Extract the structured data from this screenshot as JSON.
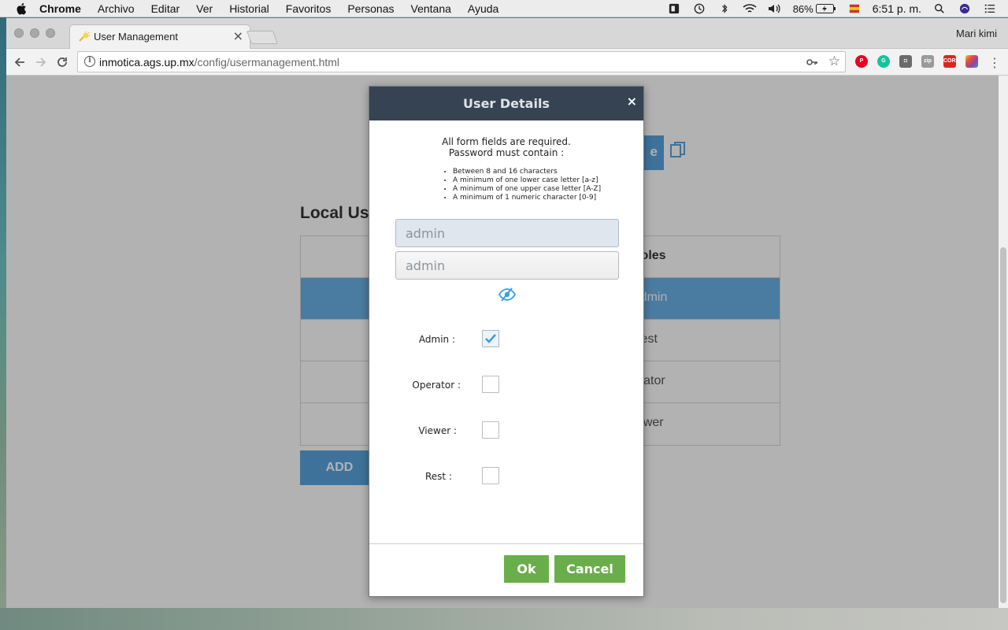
{
  "menubar": {
    "items": [
      "Chrome",
      "Archivo",
      "Editar",
      "Ver",
      "Historial",
      "Favoritos",
      "Personas",
      "Ventana",
      "Ayuda"
    ],
    "battery": "86%",
    "clock": "6:51 p. m."
  },
  "browser": {
    "tab_title": "User Management",
    "tab_close": "×",
    "profile_name": "Mari kimi",
    "url_host": "inmotica.ags.up.mx",
    "url_path": "/config/usermanagement.html",
    "extensions": [
      "pinterest-icon",
      "grammarly-icon",
      "pocket-icon",
      "gitzip-icon",
      "cors-icon",
      "colorpick-icon"
    ]
  },
  "background_page": {
    "partial_button_text": "e",
    "heading": "Local Us",
    "table_header": "Roles",
    "rows": [
      "Admin",
      "Rest",
      "perator",
      "Viewer"
    ],
    "add_button": "ADD"
  },
  "modal": {
    "title": "User Details",
    "close": "×",
    "requirement_line1": "All form fields are required.",
    "requirement_line2": "Password must contain :",
    "rules": [
      "Between 8 and 16 characters",
      "A minimum of one lower case letter [a-z]",
      "A minimum of one upper case letter [A-Z]",
      "A minimum of 1 numeric character [0-9]"
    ],
    "username_value": "admin",
    "password_value": "admin",
    "roles": [
      {
        "label": "Admin :",
        "checked": true
      },
      {
        "label": "Operator :",
        "checked": false
      },
      {
        "label": "Viewer :",
        "checked": false
      },
      {
        "label": "Rest :",
        "checked": false
      }
    ],
    "ok_label": "Ok",
    "cancel_label": "Cancel"
  },
  "colors": {
    "modal_header": "#364352",
    "button_green": "#6aae4b",
    "accent_blue": "#5aa4df",
    "check_blue": "#3aa0e0"
  }
}
